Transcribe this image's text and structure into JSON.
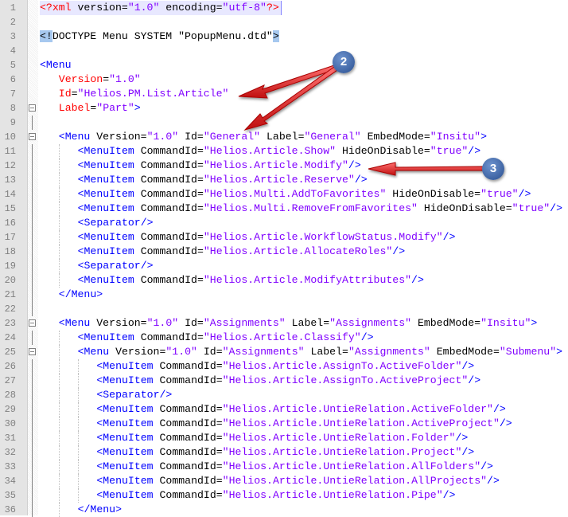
{
  "colors": {
    "tag": "#0000ff",
    "attr": "#ff0000",
    "value": "#8000ff",
    "arrow": "#e02020",
    "badge": "#3a62a8"
  },
  "annotations": {
    "badge_2": "2",
    "badge_3": "3"
  },
  "fold_markers": [
    8,
    10,
    23,
    25
  ],
  "current_line": 1,
  "lines": [
    {
      "n": "1",
      "i": 0,
      "c": "<?xml version=\"1.0\" encoding=\"utf-8\"?>"
    },
    {
      "n": "2",
      "i": 0,
      "c": ""
    },
    {
      "n": "3",
      "i": 0,
      "c": "<!DOCTYPE Menu SYSTEM \"PopupMenu.dtd\">",
      "doctype": true
    },
    {
      "n": "4",
      "i": 0,
      "c": ""
    },
    {
      "n": "5",
      "i": 0,
      "c": "<Menu"
    },
    {
      "n": "6",
      "i": 1,
      "c": "Version=\"1.0\""
    },
    {
      "n": "7",
      "i": 1,
      "c": "Id=\"Helios.PM.List.Article\""
    },
    {
      "n": "8",
      "i": 1,
      "c": "Label=\"Part\">"
    },
    {
      "n": "9",
      "i": 0,
      "c": ""
    },
    {
      "n": "10",
      "i": 1,
      "c": "<Menu Version=\"1.0\" Id=\"General\" Label=\"General\" EmbedMode=\"Insitu\">"
    },
    {
      "n": "11",
      "i": 2,
      "c": "<MenuItem CommandId=\"Helios.Article.Show\" HideOnDisable=\"true\"/>"
    },
    {
      "n": "12",
      "i": 2,
      "c": "<MenuItem CommandId=\"Helios.Article.Modify\"/>"
    },
    {
      "n": "13",
      "i": 2,
      "c": "<MenuItem CommandId=\"Helios.Article.Reserve\"/>"
    },
    {
      "n": "14",
      "i": 2,
      "c": "<MenuItem CommandId=\"Helios.Multi.AddToFavorites\" HideOnDisable=\"true\"/>"
    },
    {
      "n": "15",
      "i": 2,
      "c": "<MenuItem CommandId=\"Helios.Multi.RemoveFromFavorites\" HideOnDisable=\"true\"/>"
    },
    {
      "n": "16",
      "i": 2,
      "c": "<Separator/>"
    },
    {
      "n": "17",
      "i": 2,
      "c": "<MenuItem CommandId=\"Helios.Article.WorkflowStatus.Modify\"/>"
    },
    {
      "n": "18",
      "i": 2,
      "c": "<MenuItem CommandId=\"Helios.Article.AllocateRoles\"/>"
    },
    {
      "n": "19",
      "i": 2,
      "c": "<Separator/>"
    },
    {
      "n": "20",
      "i": 2,
      "c": "<MenuItem CommandId=\"Helios.Article.ModifyAttributes\"/>"
    },
    {
      "n": "21",
      "i": 1,
      "c": "</Menu>"
    },
    {
      "n": "22",
      "i": 0,
      "c": ""
    },
    {
      "n": "23",
      "i": 1,
      "c": "<Menu Version=\"1.0\" Id=\"Assignments\" Label=\"Assignments\" EmbedMode=\"Insitu\">"
    },
    {
      "n": "24",
      "i": 2,
      "c": "<MenuItem CommandId=\"Helios.Article.Classify\"/>"
    },
    {
      "n": "25",
      "i": 2,
      "c": "<Menu Version=\"1.0\" Id=\"Assignments\" Label=\"Assignments\" EmbedMode=\"Submenu\">"
    },
    {
      "n": "26",
      "i": 3,
      "c": "<MenuItem CommandId=\"Helios.Article.AssignTo.ActiveFolder\"/>"
    },
    {
      "n": "27",
      "i": 3,
      "c": "<MenuItem CommandId=\"Helios.Article.AssignTo.ActiveProject\"/>"
    },
    {
      "n": "28",
      "i": 3,
      "c": "<Separator/>"
    },
    {
      "n": "29",
      "i": 3,
      "c": "<MenuItem CommandId=\"Helios.Article.UntieRelation.ActiveFolder\"/>"
    },
    {
      "n": "30",
      "i": 3,
      "c": "<MenuItem CommandId=\"Helios.Article.UntieRelation.ActiveProject\"/>"
    },
    {
      "n": "31",
      "i": 3,
      "c": "<MenuItem CommandId=\"Helios.Article.UntieRelation.Folder\"/>"
    },
    {
      "n": "32",
      "i": 3,
      "c": "<MenuItem CommandId=\"Helios.Article.UntieRelation.Project\"/>"
    },
    {
      "n": "33",
      "i": 3,
      "c": "<MenuItem CommandId=\"Helios.Article.UntieRelation.AllFolders\"/>"
    },
    {
      "n": "34",
      "i": 3,
      "c": "<MenuItem CommandId=\"Helios.Article.UntieRelation.AllProjects\"/>"
    },
    {
      "n": "35",
      "i": 3,
      "c": "<MenuItem CommandId=\"Helios.Article.UntieRelation.Pipe\"/>"
    },
    {
      "n": "36",
      "i": 2,
      "c": "</Menu>"
    }
  ]
}
